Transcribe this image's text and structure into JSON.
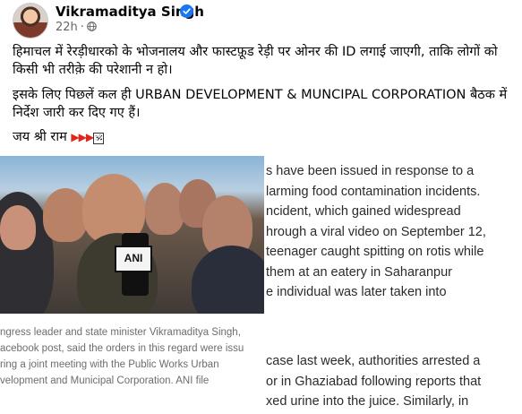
{
  "post": {
    "author": "Vikramaditya Singh",
    "time": "22h",
    "separator": "·",
    "paragraphs": [
      "हिमाचल में रेरड़ीधारको के भोजनालय और फास्टफ़ूड रेड़ी पर ओनर की ID लगाई जाएगी, ताकि लोगों को किसी भी तरीक़े की परेशानी न हो।",
      "इसके लिए पिछलें कल ही URBAN DEVELOPMENT & MUNCIPAL CORPORATION बैठक में निर्देश जारी कर दिए गए हैं।"
    ],
    "closing_text": "जय श्री राम",
    "closing_flags": "▶▶▶",
    "closing_emoji": "🕉",
    "icons": [
      "verified-icon",
      "globe-icon"
    ],
    "colors": {
      "verified": "#1877f2",
      "flag": "#e1251b"
    }
  },
  "image": {
    "badge": "ANI",
    "caption_lines": [
      "ngress leader and state minister Vikramaditya Singh,",
      "acebook post, said the orders in this regard were issu",
      "ring a joint meeting with the Public Works Urban",
      "velopment and Municipal Corporation. ANI file"
    ]
  },
  "article": {
    "lines_1": [
      "s have been issued in response to a",
      "larming food contamination incidents.",
      "ncident, which gained widespread",
      "hrough a viral video on September 12,",
      " teenager caught spitting on rotis while",
      "them at an eatery in Saharanpur",
      "e individual was later taken into"
    ],
    "lines_2": [
      "case last week, authorities arrested a",
      "or in Ghaziabad following reports that",
      "xed urine into the juice. Similarly, in"
    ]
  }
}
